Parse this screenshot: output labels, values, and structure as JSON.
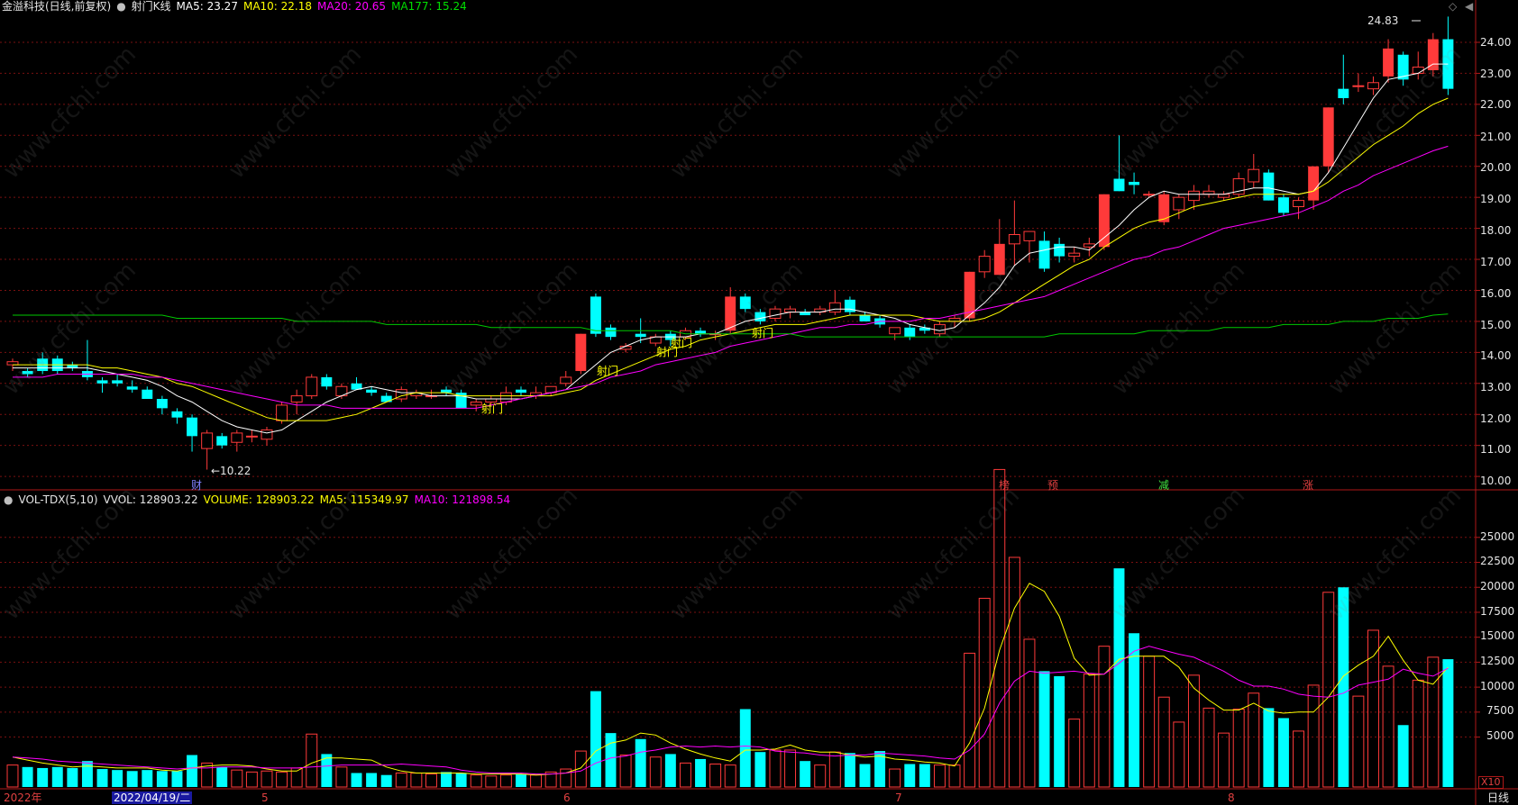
{
  "header_main": {
    "title": "金溢科技(日线,前复权)",
    "indicator": "射门K线",
    "ma5": "MA5: 23.27",
    "ma10": "MA10: 22.18",
    "ma20": "MA20: 20.65",
    "ma177": "MA177: 15.24"
  },
  "header_vol": {
    "name": "VOL-TDX(5,10)",
    "vvol": "VVOL: 128903.22",
    "volume": "VOLUME: 128903.22",
    "ma5": "MA5: 115349.97",
    "ma10": "MA10: 121898.54"
  },
  "colors": {
    "up": "#ff3a3a",
    "down": "#00ffff",
    "ma5": "#ffffff",
    "ma10": "#ffff00",
    "ma20": "#ff00ff",
    "ma177": "#00c800",
    "grid": "#7a1010",
    "border": "#b01818"
  },
  "price_axis": {
    "ticks": [
      "24.00",
      "23.00",
      "22.00",
      "21.00",
      "20.00",
      "19.00",
      "18.00",
      "17.00",
      "16.00",
      "15.00",
      "14.00",
      "13.00",
      "12.00",
      "11.00",
      "10.00"
    ]
  },
  "vol_axis": {
    "ticks": [
      "25000",
      "22500",
      "20000",
      "17500",
      "15000",
      "12500",
      "10000",
      "7500",
      "5000"
    ],
    "unit": "X10"
  },
  "annotations": {
    "high_label": "24.83",
    "low_label": "←10.22",
    "shemen": "射门",
    "cai": "财",
    "bang": "榜",
    "yu": "预",
    "jian": "减",
    "zhang": "涨"
  },
  "x_axis": {
    "year": "2022年",
    "selected_date": "2022/04/19/二",
    "m5": "5",
    "m6": "6",
    "m7": "7",
    "m8": "8",
    "period": "日线"
  },
  "icons": [
    "circle-toggle-icon",
    "diamond-icon",
    "scroll-arrow-icon"
  ],
  "chart_data": {
    "type": "candlestick",
    "title": "金溢科技(日线,前复权)",
    "ylim": [
      9.8,
      24.9
    ],
    "vol_ylim": [
      0,
      28500
    ],
    "candles": [
      [
        13.6,
        13.8,
        13.4,
        13.7
      ],
      [
        13.4,
        13.5,
        13.2,
        13.3
      ],
      [
        13.8,
        14.0,
        13.3,
        13.4
      ],
      [
        13.8,
        13.9,
        13.3,
        13.4
      ],
      [
        13.6,
        13.7,
        13.4,
        13.5
      ],
      [
        13.4,
        14.4,
        13.1,
        13.2
      ],
      [
        13.1,
        13.2,
        12.7,
        13.0
      ],
      [
        13.1,
        13.3,
        12.9,
        13.0
      ],
      [
        12.9,
        13.1,
        12.7,
        12.8
      ],
      [
        12.8,
        12.9,
        12.5,
        12.5
      ],
      [
        12.5,
        12.6,
        12.0,
        12.2
      ],
      [
        12.1,
        12.2,
        11.7,
        11.9
      ],
      [
        11.9,
        12.0,
        10.8,
        11.3
      ],
      [
        10.9,
        11.5,
        10.22,
        11.4
      ],
      [
        11.3,
        11.4,
        10.9,
        11.0
      ],
      [
        11.1,
        11.5,
        10.8,
        11.4
      ],
      [
        11.3,
        11.5,
        11.1,
        11.3
      ],
      [
        11.2,
        11.6,
        11.0,
        11.5
      ],
      [
        11.8,
        12.4,
        11.7,
        12.3
      ],
      [
        12.4,
        12.8,
        12.0,
        12.6
      ],
      [
        12.6,
        13.3,
        12.5,
        13.2
      ],
      [
        13.2,
        13.3,
        12.8,
        12.9
      ],
      [
        12.6,
        13.0,
        12.5,
        12.9
      ],
      [
        13.0,
        13.2,
        12.8,
        12.8
      ],
      [
        12.8,
        12.9,
        12.6,
        12.7
      ],
      [
        12.6,
        12.7,
        12.4,
        12.4
      ],
      [
        12.5,
        12.9,
        12.4,
        12.8
      ],
      [
        12.6,
        12.8,
        12.5,
        12.7
      ],
      [
        12.6,
        12.8,
        12.5,
        12.6
      ],
      [
        12.8,
        12.9,
        12.6,
        12.7
      ],
      [
        12.7,
        12.8,
        12.2,
        12.2
      ],
      [
        12.3,
        12.5,
        12.1,
        12.4
      ],
      [
        12.4,
        12.6,
        12.3,
        12.5
      ],
      [
        12.4,
        12.9,
        12.3,
        12.7
      ],
      [
        12.8,
        12.9,
        12.6,
        12.7
      ],
      [
        12.6,
        12.9,
        12.5,
        12.7
      ],
      [
        12.7,
        12.9,
        12.6,
        12.9
      ],
      [
        13.0,
        13.4,
        12.9,
        13.2
      ],
      [
        13.4,
        14.6,
        13.3,
        14.6
      ],
      [
        15.8,
        15.9,
        14.5,
        14.6
      ],
      [
        14.8,
        14.9,
        14.4,
        14.5
      ],
      [
        14.1,
        14.3,
        14.0,
        14.2
      ],
      [
        14.6,
        15.1,
        14.3,
        14.5
      ],
      [
        14.3,
        14.6,
        14.2,
        14.5
      ],
      [
        14.6,
        14.7,
        14.2,
        14.4
      ],
      [
        14.5,
        14.8,
        14.4,
        14.7
      ],
      [
        14.7,
        14.8,
        14.5,
        14.6
      ],
      [
        14.6,
        14.7,
        14.4,
        14.6
      ],
      [
        14.7,
        16.1,
        14.6,
        15.8
      ],
      [
        15.8,
        15.9,
        15.3,
        15.4
      ],
      [
        15.3,
        15.4,
        14.9,
        15.0
      ],
      [
        15.1,
        15.5,
        15.0,
        15.4
      ],
      [
        15.3,
        15.5,
        15.1,
        15.4
      ],
      [
        15.3,
        15.4,
        15.2,
        15.2
      ],
      [
        15.3,
        15.5,
        15.2,
        15.4
      ],
      [
        15.3,
        16.0,
        15.2,
        15.6
      ],
      [
        15.7,
        15.8,
        15.2,
        15.3
      ],
      [
        15.2,
        15.3,
        15.0,
        15.0
      ],
      [
        15.1,
        15.2,
        14.8,
        14.9
      ],
      [
        14.6,
        14.8,
        14.4,
        14.8
      ],
      [
        14.8,
        14.9,
        14.4,
        14.5
      ],
      [
        14.8,
        14.9,
        14.6,
        14.7
      ],
      [
        14.6,
        15.0,
        14.5,
        14.9
      ],
      [
        15.0,
        15.2,
        14.8,
        15.1
      ],
      [
        15.1,
        16.6,
        15.0,
        16.6
      ],
      [
        16.6,
        17.3,
        16.4,
        17.1
      ],
      [
        16.5,
        18.3,
        16.5,
        17.5
      ],
      [
        17.5,
        18.9,
        16.8,
        17.8
      ],
      [
        17.6,
        17.8,
        16.9,
        17.9
      ],
      [
        17.6,
        17.9,
        16.6,
        16.7
      ],
      [
        17.5,
        17.7,
        16.9,
        17.1
      ],
      [
        17.1,
        17.4,
        16.9,
        17.2
      ],
      [
        17.4,
        17.7,
        17.1,
        17.5
      ],
      [
        17.4,
        19.1,
        17.3,
        19.1
      ],
      [
        19.6,
        21.0,
        19.2,
        19.2
      ],
      [
        19.5,
        19.8,
        19.1,
        19.4
      ],
      [
        19.1,
        19.2,
        19.0,
        19.1
      ],
      [
        18.2,
        19.2,
        18.1,
        19.1
      ],
      [
        18.6,
        19.1,
        18.3,
        19.0
      ],
      [
        18.9,
        19.4,
        18.6,
        19.2
      ],
      [
        19.1,
        19.4,
        19.0,
        19.2
      ],
      [
        19.0,
        19.2,
        18.9,
        19.1
      ],
      [
        19.1,
        19.8,
        19.0,
        19.6
      ],
      [
        19.5,
        20.4,
        19.3,
        19.9
      ],
      [
        19.8,
        19.9,
        18.9,
        18.9
      ],
      [
        19.0,
        19.1,
        18.4,
        18.5
      ],
      [
        18.7,
        19.0,
        18.3,
        18.9
      ],
      [
        18.9,
        20.0,
        18.6,
        20.0
      ],
      [
        20.0,
        21.9,
        19.8,
        21.9
      ],
      [
        22.5,
        23.6,
        22.0,
        22.2
      ],
      [
        22.6,
        23.0,
        22.4,
        22.6
      ],
      [
        22.5,
        22.9,
        22.3,
        22.7
      ],
      [
        22.9,
        24.1,
        22.7,
        23.8
      ],
      [
        23.6,
        23.7,
        22.6,
        22.8
      ],
      [
        23.0,
        23.7,
        22.8,
        23.2
      ],
      [
        23.1,
        24.3,
        22.9,
        24.1
      ],
      [
        24.1,
        24.83,
        22.3,
        22.5
      ]
    ],
    "volumes": [
      2200,
      2000,
      1900,
      2000,
      1900,
      2600,
      1800,
      1700,
      1600,
      1700,
      1600,
      1600,
      3200,
      2400,
      2000,
      1700,
      1500,
      1600,
      1500,
      1900,
      5300,
      3300,
      2000,
      1400,
      1400,
      1200,
      1400,
      1400,
      1300,
      1500,
      1400,
      1200,
      1100,
      1200,
      1300,
      1200,
      1500,
      1800,
      3600,
      9600,
      5400,
      3200,
      4800,
      3000,
      3300,
      2400,
      2800,
      2300,
      2200,
      7800,
      3500,
      3700,
      3700,
      2600,
      2200,
      3500,
      3400,
      2300,
      3600,
      1800,
      2300,
      2300,
      2200,
      2200,
      13400,
      18900,
      31800,
      23000,
      14800,
      11600,
      11100,
      6800,
      11300,
      14100,
      21900,
      15400,
      13100,
      9000,
      6500,
      11200,
      7900,
      5400,
      7800,
      9400,
      7900,
      6900,
      5600,
      10200,
      19500,
      20000,
      9100,
      15700,
      12100,
      6200,
      10700,
      13000,
      12800
    ],
    "ma_series": [
      {
        "name": "MA5",
        "values": [
          13.5,
          13.5,
          13.5,
          13.5,
          13.5,
          13.5,
          13.4,
          13.3,
          13.2,
          13.1,
          12.9,
          12.6,
          12.4,
          12.1,
          11.8,
          11.6,
          11.5,
          11.4,
          11.5,
          11.8,
          12.1,
          12.4,
          12.6,
          12.8,
          12.9,
          12.8,
          12.7,
          12.7,
          12.6,
          12.6,
          12.6,
          12.5,
          12.5,
          12.5,
          12.5,
          12.6,
          12.7,
          12.8,
          13.2,
          13.6,
          14.0,
          14.2,
          14.4,
          14.5,
          14.5,
          14.5,
          14.6,
          14.6,
          14.8,
          15.0,
          15.1,
          15.2,
          15.3,
          15.3,
          15.3,
          15.4,
          15.4,
          15.3,
          15.2,
          15.1,
          14.9,
          14.8,
          14.7,
          14.8,
          15.2,
          15.6,
          16.1,
          16.8,
          17.2,
          17.3,
          17.4,
          17.4,
          17.3,
          17.7,
          18.1,
          18.6,
          19.0,
          19.2,
          19.1,
          19.1,
          19.1,
          19.1,
          19.2,
          19.3,
          19.3,
          19.2,
          19.1,
          19.2,
          19.8,
          20.6,
          21.4,
          22.2,
          22.8,
          22.9,
          23.0,
          23.3,
          23.3
        ]
      },
      {
        "name": "MA10",
        "values": [
          13.6,
          13.6,
          13.6,
          13.6,
          13.6,
          13.6,
          13.5,
          13.5,
          13.4,
          13.3,
          13.2,
          13.0,
          12.9,
          12.7,
          12.5,
          12.3,
          12.1,
          11.9,
          11.8,
          11.8,
          11.8,
          11.8,
          11.9,
          12.0,
          12.2,
          12.4,
          12.6,
          12.7,
          12.7,
          12.7,
          12.6,
          12.6,
          12.6,
          12.6,
          12.6,
          12.6,
          12.6,
          12.7,
          12.8,
          13.1,
          13.3,
          13.5,
          13.7,
          13.9,
          14.1,
          14.2,
          14.4,
          14.5,
          14.6,
          14.7,
          14.8,
          14.9,
          14.9,
          14.9,
          15.0,
          15.1,
          15.2,
          15.2,
          15.2,
          15.2,
          15.2,
          15.1,
          15.0,
          15.0,
          15.0,
          15.1,
          15.3,
          15.6,
          15.9,
          16.2,
          16.5,
          16.8,
          17.0,
          17.4,
          17.7,
          18.0,
          18.2,
          18.3,
          18.5,
          18.7,
          18.8,
          18.9,
          19.0,
          19.1,
          19.1,
          19.1,
          19.1,
          19.2,
          19.5,
          19.9,
          20.3,
          20.7,
          21.0,
          21.3,
          21.7,
          22.0,
          22.2
        ]
      },
      {
        "name": "MA20",
        "values": [
          13.2,
          13.2,
          13.2,
          13.3,
          13.3,
          13.3,
          13.3,
          13.3,
          13.3,
          13.2,
          13.2,
          13.1,
          13.0,
          12.9,
          12.8,
          12.7,
          12.6,
          12.5,
          12.4,
          12.3,
          12.3,
          12.3,
          12.2,
          12.2,
          12.2,
          12.2,
          12.2,
          12.2,
          12.2,
          12.2,
          12.2,
          12.2,
          12.3,
          12.4,
          12.5,
          12.6,
          12.7,
          12.8,
          12.9,
          13.0,
          13.2,
          13.3,
          13.4,
          13.6,
          13.7,
          13.8,
          13.9,
          14.0,
          14.2,
          14.3,
          14.4,
          14.5,
          14.6,
          14.7,
          14.8,
          14.8,
          14.9,
          14.9,
          15.0,
          15.0,
          15.0,
          15.1,
          15.1,
          15.2,
          15.3,
          15.4,
          15.5,
          15.6,
          15.7,
          15.8,
          16.0,
          16.2,
          16.4,
          16.6,
          16.8,
          17.0,
          17.1,
          17.3,
          17.4,
          17.6,
          17.8,
          18.0,
          18.1,
          18.2,
          18.3,
          18.4,
          18.5,
          18.7,
          18.9,
          19.2,
          19.4,
          19.7,
          19.9,
          20.1,
          20.3,
          20.5,
          20.65
        ]
      },
      {
        "name": "MA177",
        "values": [
          15.2,
          15.2,
          15.2,
          15.2,
          15.2,
          15.2,
          15.2,
          15.2,
          15.2,
          15.2,
          15.2,
          15.1,
          15.1,
          15.1,
          15.1,
          15.1,
          15.1,
          15.1,
          15.1,
          15.0,
          15.0,
          15.0,
          15.0,
          15.0,
          15.0,
          14.9,
          14.9,
          14.9,
          14.9,
          14.9,
          14.9,
          14.9,
          14.8,
          14.8,
          14.8,
          14.8,
          14.8,
          14.8,
          14.8,
          14.7,
          14.7,
          14.7,
          14.7,
          14.7,
          14.7,
          14.6,
          14.6,
          14.6,
          14.6,
          14.6,
          14.6,
          14.6,
          14.6,
          14.5,
          14.5,
          14.5,
          14.5,
          14.5,
          14.5,
          14.5,
          14.5,
          14.5,
          14.5,
          14.5,
          14.5,
          14.5,
          14.5,
          14.5,
          14.5,
          14.5,
          14.6,
          14.6,
          14.6,
          14.6,
          14.6,
          14.6,
          14.7,
          14.7,
          14.7,
          14.7,
          14.7,
          14.8,
          14.8,
          14.8,
          14.8,
          14.9,
          14.9,
          14.9,
          14.9,
          15.0,
          15.0,
          15.0,
          15.1,
          15.1,
          15.1,
          15.2,
          15.24
        ]
      }
    ],
    "vol_ma_series": [
      {
        "name": "MA5",
        "values": [
          3000,
          2700,
          2400,
          2200,
          2000,
          2100,
          2000,
          1900,
          1900,
          1900,
          1700,
          1600,
          1900,
          2100,
          2200,
          2200,
          2100,
          1800,
          1600,
          1600,
          2400,
          2900,
          2900,
          2800,
          2700,
          2000,
          1600,
          1400,
          1400,
          1400,
          1400,
          1300,
          1300,
          1300,
          1300,
          1200,
          1300,
          1400,
          1900,
          3600,
          4400,
          4700,
          5400,
          5200,
          4400,
          3800,
          3300,
          2900,
          2600,
          3700,
          3700,
          3800,
          4200,
          3700,
          3500,
          3500,
          3200,
          3000,
          3100,
          2800,
          2700,
          2500,
          2400,
          2100,
          4400,
          7900,
          13700,
          17900,
          20400,
          19600,
          17100,
          12900,
          11200,
          11300,
          12800,
          13100,
          13100,
          13100,
          12000,
          9900,
          8700,
          7700,
          7700,
          8400,
          7600,
          7400,
          7500,
          7500,
          9000,
          11100,
          12200,
          13100,
          15100,
          12700,
          10700,
          10300,
          12000
        ]
      },
      {
        "name": "MA10",
        "values": [
          3000,
          2900,
          2800,
          2600,
          2500,
          2400,
          2300,
          2200,
          2100,
          2000,
          1900,
          1800,
          1900,
          1900,
          2000,
          2000,
          2000,
          1900,
          1900,
          1900,
          2000,
          2100,
          2200,
          2200,
          2200,
          2200,
          2300,
          2200,
          2100,
          2000,
          1700,
          1500,
          1400,
          1400,
          1400,
          1300,
          1300,
          1400,
          1600,
          2400,
          2900,
          3100,
          3500,
          3700,
          4000,
          4100,
          4000,
          4100,
          4000,
          4100,
          4000,
          3600,
          3500,
          3400,
          3200,
          3100,
          3200,
          3200,
          3400,
          3300,
          3200,
          3100,
          2900,
          2800,
          3700,
          5300,
          8400,
          10600,
          11600,
          11400,
          11500,
          11600,
          11400,
          11300,
          12400,
          13600,
          14100,
          13700,
          13300,
          13000,
          12300,
          11600,
          10700,
          10100,
          10100,
          9800,
          9300,
          9100,
          9000,
          9400,
          10200,
          10500,
          10800,
          11800,
          11400,
          11100,
          11900
        ]
      }
    ]
  }
}
